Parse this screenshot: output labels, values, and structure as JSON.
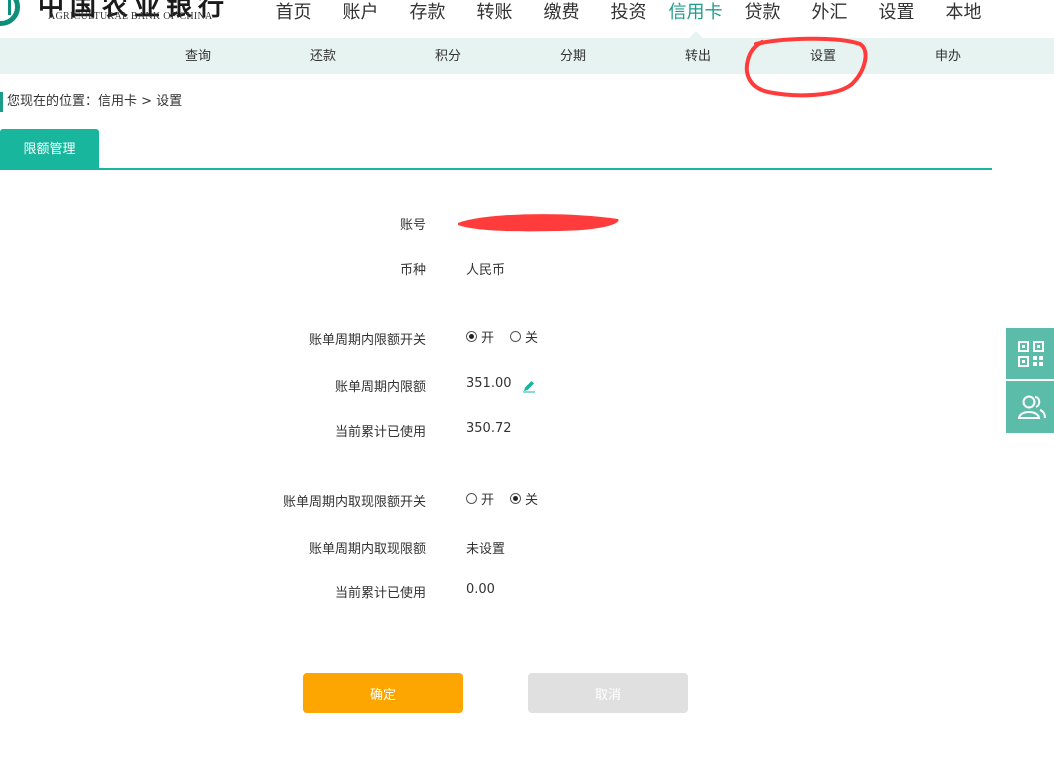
{
  "header": {
    "logo_cn": "中国农业银行",
    "logo_en": "AGRICULTURAL BANK OF CHINA",
    "nav": [
      "首页",
      "账户",
      "存款",
      "转账",
      "缴费",
      "投资",
      "信用卡",
      "贷款",
      "外汇",
      "设置",
      "本地"
    ],
    "active_nav": "信用卡"
  },
  "sub_nav": {
    "items": [
      "查询",
      "还款",
      "积分",
      "分期",
      "转出",
      "设置",
      "申办"
    ],
    "active": "设置",
    "annotation_color": "#ff3b3b"
  },
  "breadcrumb": "您现在的位置：信用卡 > 设置",
  "tab": {
    "label": "限额管理"
  },
  "form": {
    "account_label": "账号",
    "account_value_redacted": true,
    "currency_label": "币种",
    "currency_value": "人民币",
    "bill_limit_switch_label": "账单周期内限额开关",
    "bill_limit_switch_on": "开",
    "bill_limit_switch_off": "关",
    "bill_limit_switch_selected": "开",
    "bill_limit_label": "账单周期内限额",
    "bill_limit_value": "351.00",
    "bill_used_label": "当前累计已使用",
    "bill_used_value": "350.72",
    "cash_limit_switch_label": "账单周期内取现限额开关",
    "cash_limit_switch_on": "开",
    "cash_limit_switch_off": "关",
    "cash_limit_switch_selected": "关",
    "cash_limit_label": "账单周期内取现限额",
    "cash_limit_value": "未设置",
    "cash_used_label": "当前累计已使用",
    "cash_used_value": "0.00"
  },
  "buttons": {
    "confirm": "确定",
    "cancel": "取消"
  },
  "side_tools": [
    "qr-code-icon",
    "customer-service-icon"
  ],
  "colors": {
    "brand": "#17b69d",
    "confirm": "#fda500",
    "cancel": "#e0e0e0",
    "subnav_bg": "#e7f3f1",
    "redaction": "#ff3b3b"
  }
}
